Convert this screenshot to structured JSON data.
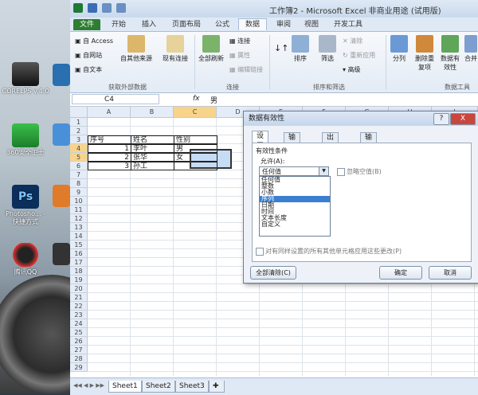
{
  "desktop": {
    "icons": [
      {
        "label": "CORELPS v.4.0"
      },
      {
        "label": "360安全卫士"
      },
      {
        "label": "Photosho... - 快捷方式"
      },
      {
        "label": "腾讯QQ"
      }
    ],
    "partial_label": "腾讯"
  },
  "excel": {
    "title": "工作簿2 - Microsoft Excel 非商业用途 (试用版)",
    "tabs": [
      "文件",
      "开始",
      "插入",
      "页面布局",
      "公式",
      "数据",
      "审阅",
      "视图",
      "开发工具"
    ],
    "ribbon": {
      "access": "自 Access",
      "web": "自网站",
      "text": "自文本",
      "other_sources": "自其他来源",
      "existing": "现有连接",
      "group_external": "获取外部数据",
      "refresh": "全部刷新",
      "connections": "连接",
      "properties": "属性",
      "edit_links": "编辑链接",
      "group_connections": "连接",
      "sort": "排序",
      "filter": "筛选",
      "clear": "清除",
      "reapply": "重新应用",
      "advanced": "高级",
      "group_sort": "排序和筛选",
      "split": "分列",
      "remove_dup": "删除重复项",
      "validation": "数据有效性",
      "consolidate": "合并",
      "group_tools": "数据工具"
    },
    "formula_bar": {
      "cell_ref": "C4",
      "fx": "fx",
      "value": "男"
    },
    "columns": [
      "A",
      "B",
      "C",
      "D",
      "E",
      "F",
      "G",
      "H",
      "I"
    ],
    "rows": [
      "1",
      "2",
      "3",
      "4",
      "5",
      "6",
      "7",
      "8",
      "9",
      "10",
      "11",
      "12",
      "13",
      "14",
      "15",
      "16",
      "17",
      "18",
      "19",
      "20",
      "21",
      "22",
      "23",
      "24",
      "25",
      "26",
      "27",
      "28",
      "29"
    ],
    "cells": {
      "a3": "序号",
      "b3": "姓名",
      "c3": "性别",
      "a4": "1",
      "b4": "李叶",
      "c4": "男",
      "a5": "2",
      "b5": "张华",
      "c5": "女",
      "a6": "3",
      "b6": "孙工"
    },
    "sheets": [
      "Sheet1",
      "Sheet2",
      "Sheet3"
    ]
  },
  "dialog": {
    "title": "数据有效性",
    "help": "?",
    "close": "X",
    "tabs": [
      "设置",
      "输入信息",
      "出错警告",
      "输入法模式"
    ],
    "criteria_label": "有效性条件",
    "allow_label": "允许(A):",
    "allow_value": "任何值",
    "ignore_blank": "忽略空值(B)",
    "options": [
      "任何值",
      "整数",
      "小数",
      "序列",
      "日期",
      "时间",
      "文本长度",
      "自定义"
    ],
    "apply_all": "对有同样设置的所有其他单元格应用这些更改(P)",
    "clear_all": "全部清除(C)",
    "ok": "确定",
    "cancel": "取消"
  }
}
